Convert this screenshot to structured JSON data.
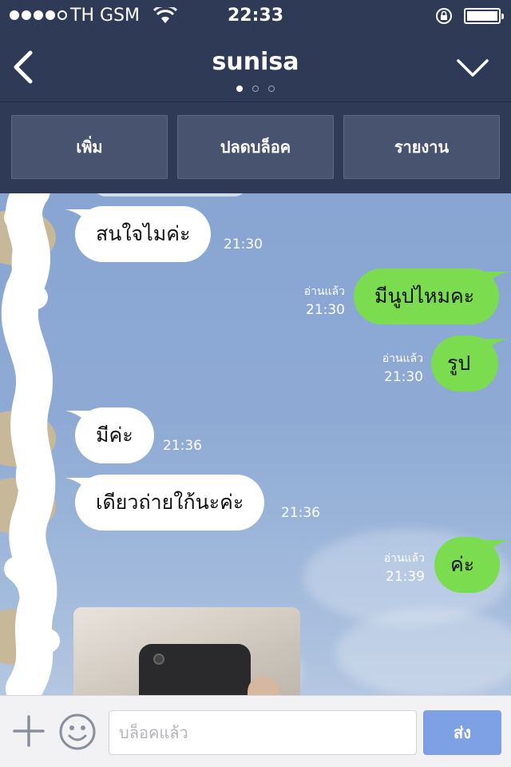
{
  "status_bar": {
    "carrier": "TH GSM",
    "time": "22:33",
    "signal_bars_filled": 4,
    "signal_bars_total": 5
  },
  "nav": {
    "back_icon": "chevron-left-icon",
    "title": "sunisa",
    "menu_icon": "chevron-down-icon",
    "page_count": 3,
    "active_page": 1
  },
  "actions": {
    "add": "เพิ่ม",
    "unblock": "ปลดบล็อค",
    "report": "รายงาน"
  },
  "messages": [
    {
      "direction": "in",
      "text": "สนใจไมค่ะ",
      "time": "21:30"
    },
    {
      "direction": "out",
      "text": "มีนูปไหมคะ",
      "time": "21:30",
      "read": "อ่านแล้ว"
    },
    {
      "direction": "out",
      "text": "รูป",
      "time": "21:30",
      "read": "อ่านแล้ว"
    },
    {
      "direction": "in",
      "text": "มีค่ะ",
      "time": "21:36"
    },
    {
      "direction": "in",
      "text": "เดียวถ่ายใก้นะค่ะ",
      "time": "21:36"
    },
    {
      "direction": "out",
      "text": "ค่ะ",
      "time": "21:39",
      "read": "อ่านแล้ว"
    }
  ],
  "input": {
    "placeholder": "บล็อคแล้ว",
    "send_label": "ส่ง",
    "plus_icon": "plus-icon",
    "emoji_icon": "emoji-icon"
  },
  "colors": {
    "header_bg": "#2e3a56",
    "action_button_bg": "#48546f",
    "outgoing_bubble": "#7bdc4f",
    "incoming_bubble": "#ffffff",
    "send_button": "#7ea1e5"
  }
}
